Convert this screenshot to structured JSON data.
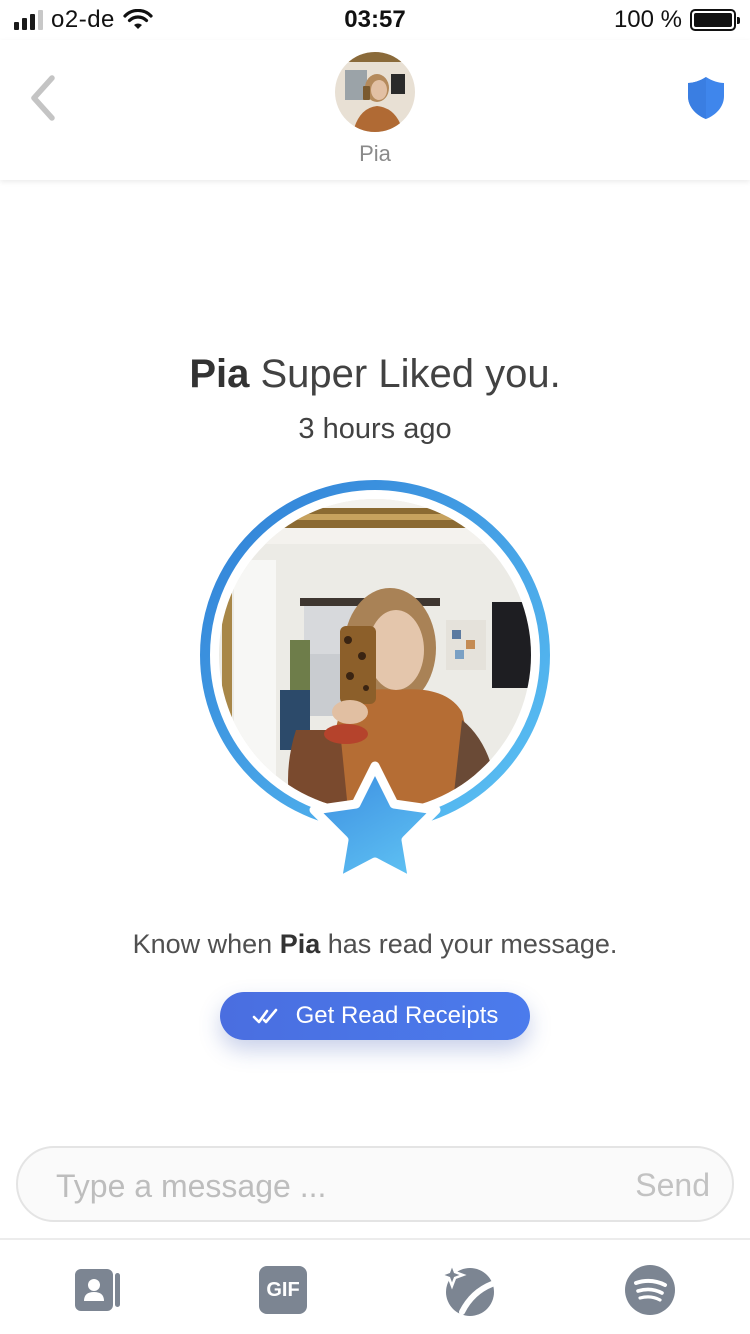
{
  "status_bar": {
    "carrier": "o2-de",
    "time": "03:57",
    "battery": "100 %"
  },
  "header": {
    "name": "Pia"
  },
  "superlike": {
    "name": "Pia",
    "text": "Super Liked you.",
    "time_ago": "3 hours ago"
  },
  "read_receipts": {
    "prefix": "Know when",
    "name": "Pia",
    "suffix": "has read your message.",
    "button_label": "Get Read Receipts"
  },
  "composer": {
    "placeholder": "Type a message ...",
    "value": "",
    "send_label": "Send"
  },
  "tabbar": {
    "gif_label": "GIF",
    "icons": [
      "contact-card-icon",
      "gif-icon",
      "sparkle-icon",
      "spotify-icon"
    ]
  },
  "colors": {
    "accent_blue": "#4a78e4",
    "shield_blue": "#3f86ec",
    "icon_gray": "#7c8592"
  }
}
